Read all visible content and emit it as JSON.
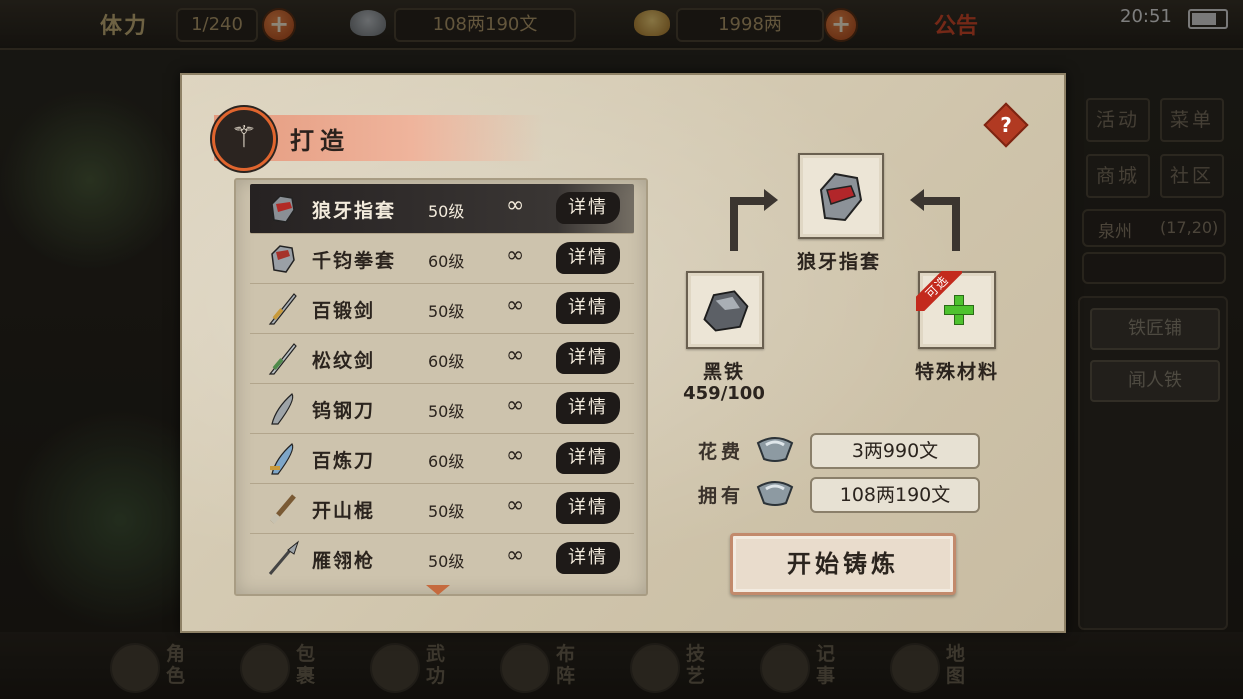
{
  "topbar": {
    "stamina_label": "体力",
    "stamina_value": "1/240",
    "silver_value": "108两190文",
    "gold_value": "1998两",
    "notice": "公告",
    "time": "20:51"
  },
  "sidebar": {
    "activity": "活动",
    "menu": "菜单",
    "shop": "商城",
    "community": "社区",
    "location": "泉州",
    "coords": "(17,20)",
    "blacksmith": "铁匠铺",
    "npc": "闻人铁"
  },
  "bottom_menu": [
    {
      "label": "角色",
      "icon": "character-icon"
    },
    {
      "label": "包裹",
      "icon": "bag-icon"
    },
    {
      "label": "武功",
      "icon": "martial-arts-icon"
    },
    {
      "label": "布阵",
      "icon": "formation-icon"
    },
    {
      "label": "技艺",
      "icon": "crafting-icon"
    },
    {
      "label": "记事",
      "icon": "journal-icon"
    },
    {
      "label": "地图",
      "icon": "map-icon"
    }
  ],
  "dialog": {
    "title": "打造",
    "help": "?",
    "items": [
      {
        "name": "狼牙指套",
        "level": "50级",
        "count": "∞",
        "detail": "详情",
        "selected": true,
        "icon": "gauntlet-icon"
      },
      {
        "name": "千钧拳套",
        "level": "60级",
        "count": "∞",
        "detail": "详情",
        "selected": false,
        "icon": "gauntlet-icon"
      },
      {
        "name": "百锻剑",
        "level": "50级",
        "count": "∞",
        "detail": "详情",
        "selected": false,
        "icon": "sword-icon"
      },
      {
        "name": "松纹剑",
        "level": "60级",
        "count": "∞",
        "detail": "详情",
        "selected": false,
        "icon": "sword-icon"
      },
      {
        "name": "钨钢刀",
        "level": "50级",
        "count": "∞",
        "detail": "详情",
        "selected": false,
        "icon": "blade-icon"
      },
      {
        "name": "百炼刀",
        "level": "60级",
        "count": "∞",
        "detail": "详情",
        "selected": false,
        "icon": "blade-icon"
      },
      {
        "name": "开山棍",
        "level": "50级",
        "count": "∞",
        "detail": "详情",
        "selected": false,
        "icon": "staff-icon"
      },
      {
        "name": "雁翎枪",
        "level": "50级",
        "count": "∞",
        "detail": "详情",
        "selected": false,
        "icon": "spear-icon"
      }
    ],
    "result_name": "狼牙指套",
    "material_name": "黑铁",
    "material_count": "459/100",
    "special_name": "特殊材料",
    "special_tag": "可选",
    "cost_label": "花费",
    "cost_value": "3两990文",
    "own_label": "拥有",
    "own_value": "108两190文",
    "craft_button": "开始铸炼"
  }
}
